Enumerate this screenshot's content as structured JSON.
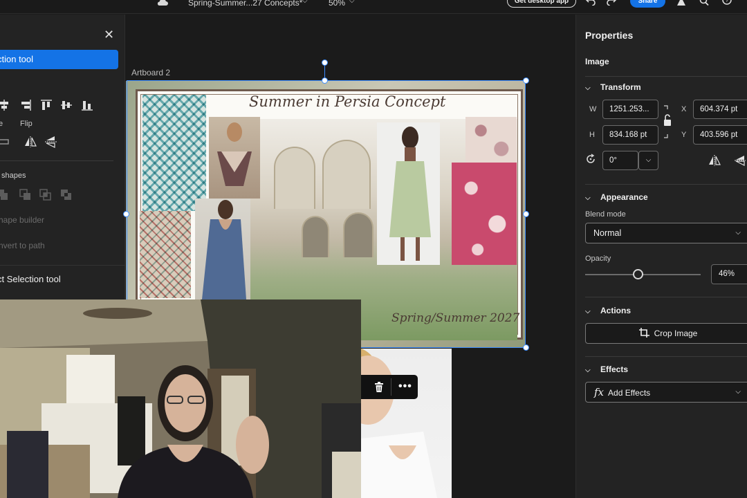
{
  "topbar": {
    "document_title": "Spring-Summer...27 Concepts*",
    "zoom": "50%",
    "get_app_label": "Get desktop app",
    "share_label": "Share"
  },
  "left_panel": {
    "selection_tool_label": "ction tool",
    "flip_label": "Flip",
    "e_label": "e",
    "shapes_label": "shapes",
    "shape_builder_label": "hape builder",
    "convert_to_path_label": "nvert to path",
    "direct_selection_label": "ct Selection tool"
  },
  "canvas": {
    "artboard_label": "Artboard 2",
    "moodboard_title": "Summer in Persia Concept",
    "moodboard_season": "Spring/Summer 2027"
  },
  "properties": {
    "title": "Properties",
    "object_type": "Image",
    "transform": {
      "section_label": "Transform",
      "w_label": "W",
      "h_label": "H",
      "x_label": "X",
      "y_label": "Y",
      "width": "1251.253...",
      "height": "834.168 pt",
      "x": "604.374 pt",
      "y": "403.596 pt",
      "rotation": "0°"
    },
    "appearance": {
      "section_label": "Appearance",
      "blend_mode_label": "Blend mode",
      "blend_mode": "Normal",
      "opacity_label": "Opacity",
      "opacity": "46%",
      "opacity_value": 0.46
    },
    "actions": {
      "section_label": "Actions",
      "crop_label": "Crop Image"
    },
    "effects": {
      "section_label": "Effects",
      "add_effects_label": "Add Effects"
    }
  },
  "colors": {
    "accent": "#1473e6",
    "selection": "#3b8cff",
    "panel_bg": "#232323",
    "canvas_bg": "#1b1b1b"
  }
}
